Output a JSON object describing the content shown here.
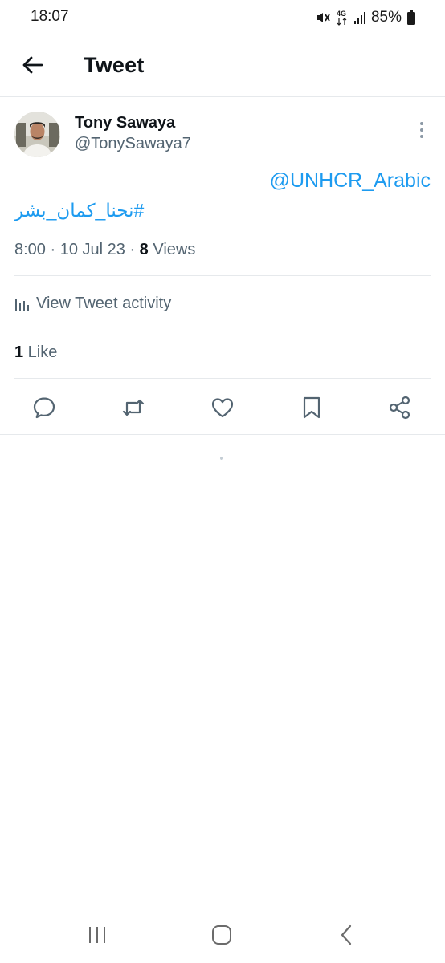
{
  "status_bar": {
    "time": "18:07",
    "network": "4G",
    "battery": "85%",
    "icons": [
      "mute-vibrate-icon",
      "network-4g-icon",
      "signal-icon",
      "battery-icon"
    ]
  },
  "header": {
    "title": "Tweet",
    "back_icon": "arrow-left-icon"
  },
  "tweet": {
    "author": {
      "name": "Tony Sawaya",
      "handle": "@TonySawaya7"
    },
    "mention": "@UNHCR_Arabic",
    "hashtag": "#نحنا_كمان_بشر",
    "meta": {
      "time": "8:00",
      "sep1": " · ",
      "date": "10 Jul 23",
      "sep2": " · ",
      "views_count": "8",
      "views_label": " Views"
    },
    "activity_label": "View Tweet activity",
    "likes": {
      "count": "1",
      "label": " Like"
    },
    "actions": [
      "reply-icon",
      "retweet-icon",
      "like-icon",
      "bookmark-icon",
      "share-icon"
    ]
  },
  "colors": {
    "accent": "#1d9bf0",
    "text_primary": "#0f1419",
    "text_secondary": "#536471",
    "divider": "#e6e9ec"
  },
  "nav_bar": {
    "buttons": [
      "recent-apps-icon",
      "home-icon",
      "back-icon"
    ]
  }
}
